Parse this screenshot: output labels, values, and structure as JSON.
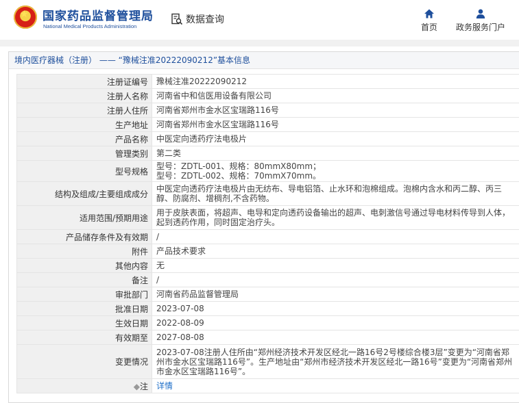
{
  "header": {
    "brand_cn": "国家药品监督管理局",
    "brand_en": "National Medical Products Administration",
    "data_query": "数据查询",
    "nav": {
      "home": "首页",
      "portal": "政务服务门户"
    }
  },
  "breadcrumb": "境内医疗器械（注册） —— “豫械注准20222090212”基本信息",
  "rows": [
    {
      "label": "注册证编号",
      "value": "豫械注准20222090212"
    },
    {
      "label": "注册人名称",
      "value": "河南省中和信医用设备有限公司"
    },
    {
      "label": "注册人住所",
      "value": "河南省郑州市金水区宝瑞路116号"
    },
    {
      "label": "生产地址",
      "value": "河南省郑州市金水区宝瑞路116号"
    },
    {
      "label": "产品名称",
      "value": "中医定向透药疗法电极片"
    },
    {
      "label": "管理类别",
      "value": "第二类"
    },
    {
      "label": "型号规格",
      "value": "型号：ZDTL-001、规格：80mmX80mm；\n型号：ZDTL-002、规格：70mmX70mm。"
    },
    {
      "label": "结构及组成/主要组成成分",
      "value": "中医定向透药疗法电极片由无纺布、导电铝箔、止水环和泡棉组成。泡棉内含水和丙二醇、丙三醇、防腐剂、增稠剂,不含药物。"
    },
    {
      "label": "适用范围/预期用途",
      "value": "用于皮肤表面，将超声、电导和定向透药设备输出的超声、电刺激信号通过导电材料传导到人体，起到透药作用，同时固定治疗头。"
    },
    {
      "label": "产品储存条件及有效期",
      "value": "/"
    },
    {
      "label": "附件",
      "value": "产品技术要求"
    },
    {
      "label": "其他内容",
      "value": "无"
    },
    {
      "label": "备注",
      "value": "/"
    },
    {
      "label": "审批部门",
      "value": "河南省药品监督管理局"
    },
    {
      "label": "批准日期",
      "value": "2023-07-08"
    },
    {
      "label": "生效日期",
      "value": "2022-08-09"
    },
    {
      "label": "有效期至",
      "value": "2027-08-08"
    },
    {
      "label": "变更情况",
      "value": "2023-07-08注册人住所由“郑州经济技术开发区经北一路16号2号楼综合楼3层”变更为“河南省郑州市金水区宝瑞路116号”。生产地址由“郑州市经济技术开发区经北一路16号”变更为“河南省郑州市金水区宝瑞路116号”。"
    },
    {
      "label": "",
      "value": "详情"
    }
  ],
  "note_label_glyph": "注",
  "colors": {
    "brand": "#1e4f9c",
    "link": "#1e6ec8",
    "label_bg": "#f0f0f0"
  }
}
